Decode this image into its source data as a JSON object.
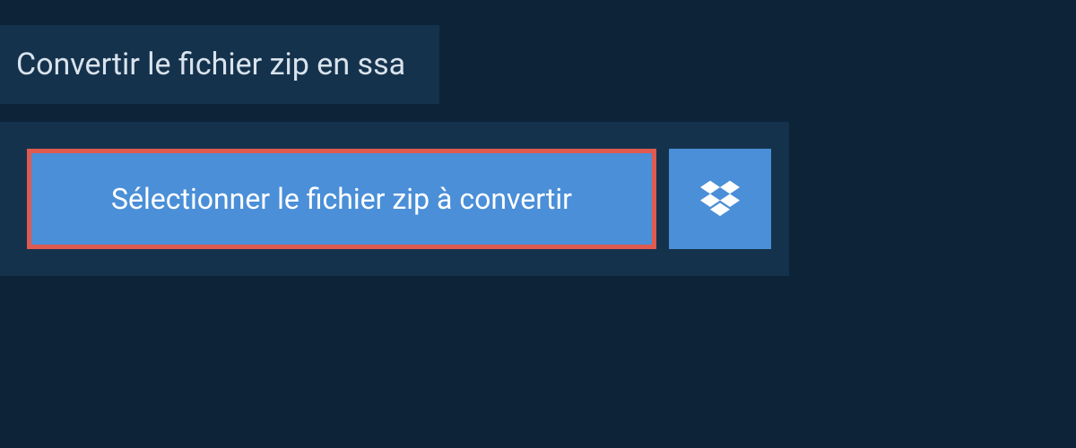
{
  "header": {
    "title": "Convertir le fichier zip en ssa"
  },
  "actions": {
    "select_file_label": "Sélectionner le fichier zip à convertir"
  }
}
